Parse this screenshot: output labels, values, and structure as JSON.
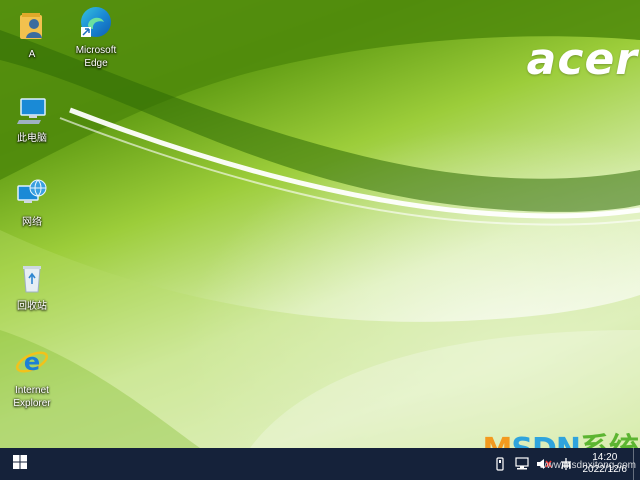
{
  "desktop": {
    "brand_logo": "acer",
    "icons": [
      {
        "label": "A",
        "icon": "user-folder-icon"
      },
      {
        "label": "Microsoft\nEdge",
        "icon": "edge-icon"
      },
      {
        "label": "此电脑",
        "icon": "this-pc-icon"
      },
      {
        "label": "网络",
        "icon": "network-icon"
      },
      {
        "label": "回收站",
        "icon": "recycle-bin-icon"
      },
      {
        "label": "Internet\nExplorer",
        "icon": "internet-explorer-icon"
      }
    ]
  },
  "taskbar": {
    "start_icon": "windows-start-icon",
    "tray_icons": [
      "usb-icon",
      "network-tray-icon",
      "volume-muted-icon",
      "ime-icon"
    ],
    "clock_time": "14:20",
    "clock_date": "2022/12/6"
  },
  "watermark": {
    "part1": "M",
    "part2": "SDN",
    "part3": "系统",
    "url": "www.msdnxitong.com"
  },
  "colors": {
    "taskbar": "#15223a",
    "wallpaper_green": "#6aa816",
    "watermark_orange": "#f39a1f",
    "watermark_blue": "#2fa4dd",
    "watermark_green": "#5cb531"
  }
}
